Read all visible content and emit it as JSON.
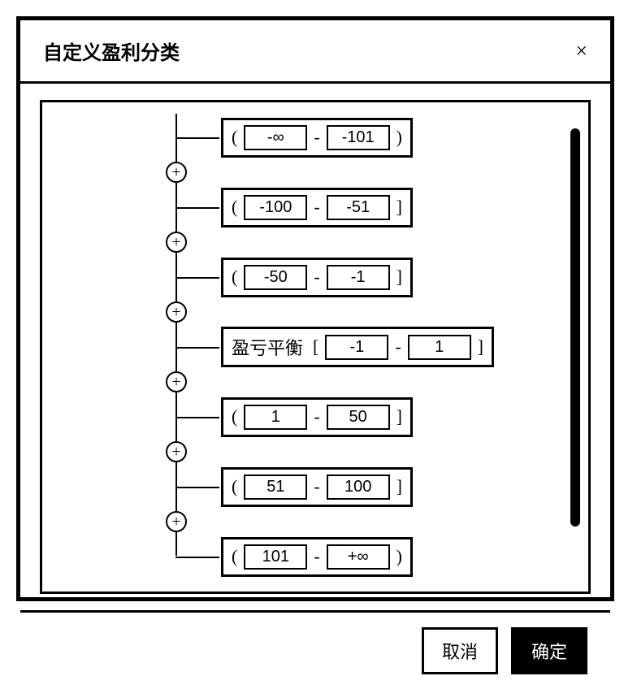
{
  "dialog": {
    "title": "自定义盈利分类",
    "close_glyph": "×"
  },
  "ranges": [
    {
      "label": "",
      "open": "(",
      "from": "-∞",
      "to": "-101",
      "close": ")"
    },
    {
      "label": "",
      "open": "(",
      "from": "-100",
      "to": "-51",
      "close": "]"
    },
    {
      "label": "",
      "open": "(",
      "from": "-50",
      "to": "-1",
      "close": "]"
    },
    {
      "label": "盈亏平衡",
      "open": "[",
      "from": "-1",
      "to": "1",
      "close": "]"
    },
    {
      "label": "",
      "open": "(",
      "from": "1",
      "to": "50",
      "close": "]"
    },
    {
      "label": "",
      "open": "(",
      "from": "51",
      "to": "100",
      "close": "]"
    },
    {
      "label": "",
      "open": "(",
      "from": "101",
      "to": "+∞",
      "close": ")"
    }
  ],
  "glyphs": {
    "dash": "-",
    "plus": "+"
  },
  "footer": {
    "cancel": "取消",
    "ok": "确定"
  }
}
